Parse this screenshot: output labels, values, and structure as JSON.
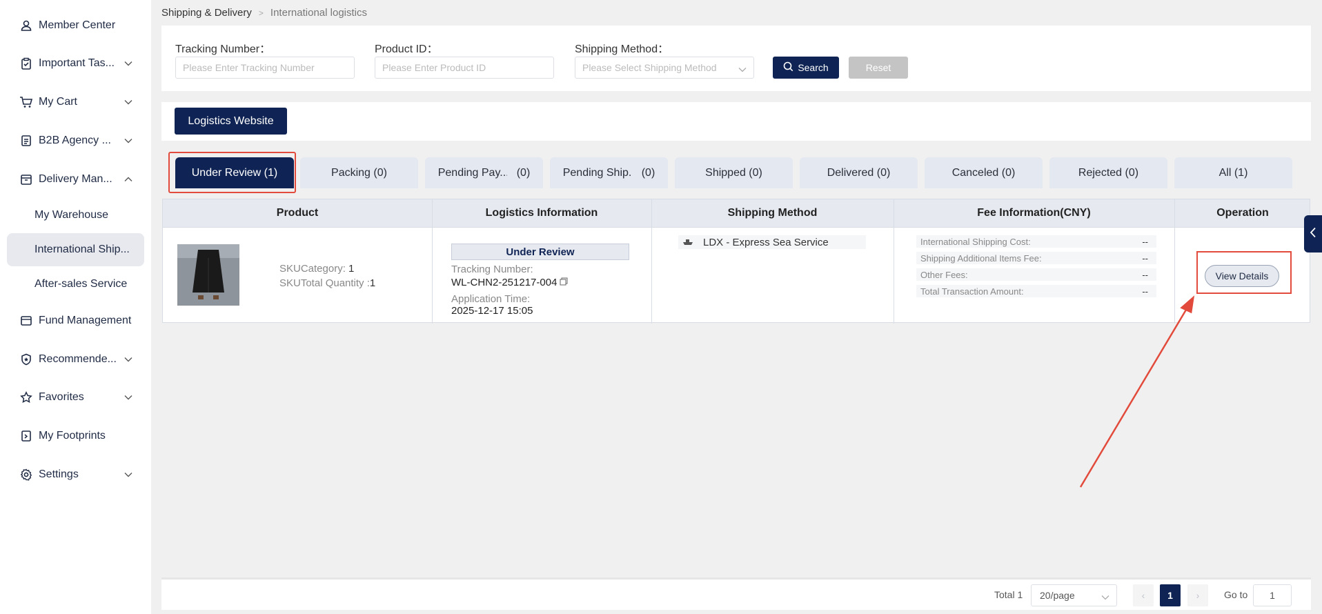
{
  "sidebar": {
    "items": [
      {
        "label": "Member Center",
        "icon": "user-icon",
        "chevron": ""
      },
      {
        "label": "Important Tas...",
        "icon": "clipboard-check-icon",
        "chevron": "down"
      },
      {
        "label": "My Cart",
        "icon": "cart-icon",
        "chevron": "down"
      },
      {
        "label": "B2B Agency ...",
        "icon": "document-icon",
        "chevron": "down"
      },
      {
        "label": "Delivery Man...",
        "icon": "box-icon",
        "chevron": "up"
      },
      {
        "label": "Fund Management",
        "icon": "wallet-icon",
        "chevron": ""
      },
      {
        "label": "Recommende...",
        "icon": "badge-icon",
        "chevron": "down"
      },
      {
        "label": "Favorites",
        "icon": "star-icon",
        "chevron": "down"
      },
      {
        "label": "My Footprints",
        "icon": "footprint-icon",
        "chevron": ""
      },
      {
        "label": "Settings",
        "icon": "gear-icon",
        "chevron": "down"
      }
    ],
    "subitems": [
      {
        "label": "My Warehouse"
      },
      {
        "label": "International Ship..."
      },
      {
        "label": "After-sales Service"
      }
    ]
  },
  "breadcrumb": {
    "parent": "Shipping & Delivery",
    "current": "International logistics"
  },
  "search": {
    "tracking_label": "Tracking Number：",
    "tracking_placeholder": "Please Enter Tracking Number",
    "product_label": "Product ID：",
    "product_placeholder": "Please Enter Product ID",
    "method_label": "Shipping Method：",
    "method_placeholder": "Please Select Shipping Method",
    "search_button": "Search",
    "reset_button": "Reset"
  },
  "logistics_button": "Logistics Website",
  "tabs": [
    {
      "label": "Under Review (1)",
      "count": ""
    },
    {
      "label": "Packing (0)",
      "count": ""
    },
    {
      "label": "Pending Pay...",
      "count": "(0)"
    },
    {
      "label": "Pending Ship...",
      "count": "(0)"
    },
    {
      "label": "Shipped (0)",
      "count": ""
    },
    {
      "label": "Delivered (0)",
      "count": ""
    },
    {
      "label": "Canceled (0)",
      "count": ""
    },
    {
      "label": "Rejected (0)",
      "count": ""
    },
    {
      "label": "All (1)",
      "count": ""
    }
  ],
  "table": {
    "headers": [
      "Product",
      "Logistics Information",
      "Shipping Method",
      "Fee Information(CNY)",
      "Operation"
    ],
    "row": {
      "sku_category_label": "SKUCategory:",
      "sku_category_value": "1",
      "sku_quantity_label": "SKUTotal Quantity :",
      "sku_quantity_value": "1",
      "status": "Under Review",
      "tracking_label": "Tracking Number:",
      "tracking_value": "WL-CHN2-251217-004",
      "application_label": "Application Time:",
      "application_value": "2025-12-17 15:05",
      "shipping_method": "LDX - Express Sea Service",
      "fees": [
        {
          "label": "International Shipping Cost:",
          "value": "--"
        },
        {
          "label": "Shipping Additional Items Fee:",
          "value": "--"
        },
        {
          "label": "Other Fees:",
          "value": "--"
        },
        {
          "label": "Total Transaction Amount:",
          "value": "--"
        }
      ],
      "action": "View Details"
    }
  },
  "pagination": {
    "total": "Total 1",
    "page_size": "20/page",
    "current_page": "1",
    "goto_label": "Go to",
    "goto_value": "1"
  },
  "colors": {
    "primary": "#0f2454",
    "highlight": "#e24b3b",
    "header_bg": "#e6e9f0"
  }
}
